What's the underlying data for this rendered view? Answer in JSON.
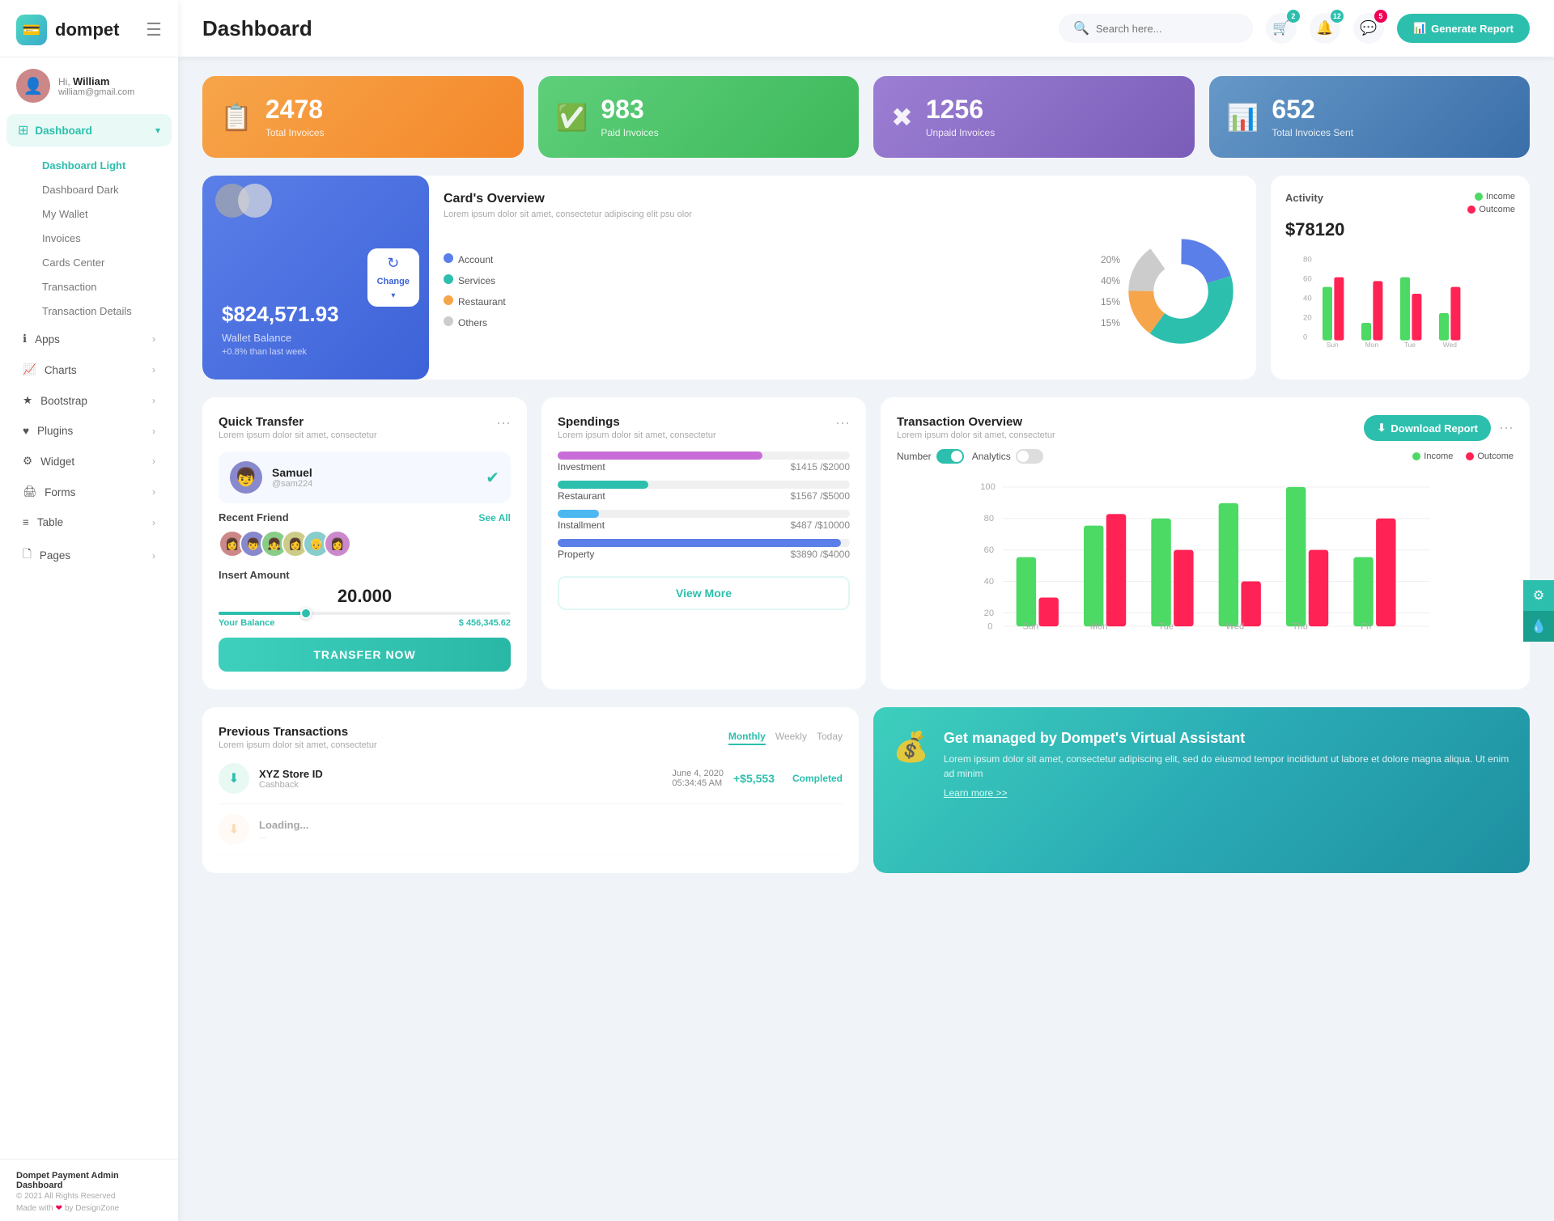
{
  "sidebar": {
    "logo": "dompet",
    "logo_icon": "💳",
    "hamburger": "☰",
    "user": {
      "greeting": "Hi,",
      "name": "William",
      "email": "william@gmail.com",
      "avatar": "👤"
    },
    "nav": [
      {
        "id": "dashboard",
        "label": "Dashboard",
        "icon": "⊞",
        "active": true,
        "arrow": "▾",
        "sub": [
          {
            "label": "Dashboard Light",
            "active": true
          },
          {
            "label": "Dashboard Dark"
          },
          {
            "label": "My Wallet"
          },
          {
            "label": "Invoices"
          },
          {
            "label": "Cards Center"
          },
          {
            "label": "Transaction"
          },
          {
            "label": "Transaction Details"
          }
        ]
      },
      {
        "id": "apps",
        "label": "Apps",
        "icon": "ℹ",
        "arrow": "›"
      },
      {
        "id": "charts",
        "label": "Charts",
        "icon": "📈",
        "arrow": "›"
      },
      {
        "id": "bootstrap",
        "label": "Bootstrap",
        "icon": "★",
        "arrow": "›"
      },
      {
        "id": "plugins",
        "label": "Plugins",
        "icon": "♥",
        "arrow": "›"
      },
      {
        "id": "widget",
        "label": "Widget",
        "icon": "⚙",
        "arrow": "›"
      },
      {
        "id": "forms",
        "label": "Forms",
        "icon": "🖨",
        "arrow": "›"
      },
      {
        "id": "table",
        "label": "Table",
        "icon": "≡",
        "arrow": "›"
      },
      {
        "id": "pages",
        "label": "Pages",
        "icon": "🗋",
        "arrow": "›"
      }
    ],
    "footer": {
      "title": "Dompet Payment Admin Dashboard",
      "copy": "© 2021 All Rights Reserved",
      "made": "Made with ❤ by DesignZone"
    }
  },
  "header": {
    "title": "Dashboard",
    "search_placeholder": "Search here...",
    "search_icon": "🔍",
    "icons": [
      {
        "id": "bell",
        "icon": "🛒",
        "badge": "2",
        "badge_color": "teal"
      },
      {
        "id": "notification",
        "icon": "🔔",
        "badge": "12",
        "badge_color": "teal"
      },
      {
        "id": "messages",
        "icon": "💬",
        "badge": "5",
        "badge_color": "red"
      }
    ],
    "btn_generate": "Generate Report"
  },
  "stats": [
    {
      "label": "Total Invoices",
      "value": "2478",
      "icon": "📋",
      "color": "stat-orange"
    },
    {
      "label": "Paid Invoices",
      "value": "983",
      "icon": "✅",
      "color": "stat-green"
    },
    {
      "label": "Unpaid Invoices",
      "value": "1256",
      "icon": "✖",
      "color": "stat-purple"
    },
    {
      "label": "Total Invoices Sent",
      "value": "652",
      "icon": "📊",
      "color": "stat-blue"
    }
  ],
  "wallet_card": {
    "amount": "$824,571.93",
    "label": "Wallet Balance",
    "change": "+0.8% than last week",
    "refresh_label": "Change"
  },
  "card_overview": {
    "title": "Card's Overview",
    "desc": "Lorem ipsum dolor sit amet, consectetur adipiscing elit psu olor",
    "items": [
      {
        "label": "Account",
        "pct": "20%",
        "color": "#5b7fe8"
      },
      {
        "label": "Services",
        "pct": "40%",
        "color": "#2dbfad"
      },
      {
        "label": "Restaurant",
        "pct": "15%",
        "color": "#f7a54a"
      },
      {
        "label": "Others",
        "pct": "15%",
        "color": "#ccc"
      }
    ]
  },
  "activity": {
    "title": "Activity",
    "amount": "$78120",
    "legend": [
      {
        "label": "Income",
        "color": "#4cd964"
      },
      {
        "label": "Outcome",
        "color": "#f25"
      },
      {
        "label": "Outcome",
        "color": "#f25"
      }
    ],
    "bars": {
      "labels": [
        "Sun",
        "Mon",
        "Tue",
        "Wed"
      ],
      "income": [
        55,
        15,
        65,
        30
      ],
      "outcome": [
        70,
        60,
        45,
        55
      ]
    }
  },
  "quick_transfer": {
    "title": "Quick Transfer",
    "desc": "Lorem ipsum dolor sit amet, consectetur",
    "user": {
      "name": "Samuel",
      "handle": "@sam224",
      "avatar": "👦"
    },
    "recent_label": "Recent Friend",
    "see_all": "See All",
    "avatars": [
      "👩",
      "👦",
      "👧",
      "👩‍🦱",
      "👴",
      "👩‍🦰"
    ],
    "insert_amount_label": "Insert Amount",
    "amount": "20.000",
    "balance_label": "Your Balance",
    "balance_value": "$ 456,345.62",
    "btn_label": "TRANSFER NOW"
  },
  "spendings": {
    "title": "Spendings",
    "desc": "Lorem ipsum dolor sit amet, consectetur",
    "items": [
      {
        "label": "Investment",
        "amount": "$1415",
        "total": "$2000",
        "pct": 70,
        "color": "#c86dd7"
      },
      {
        "label": "Restaurant",
        "amount": "$1567",
        "total": "$5000",
        "pct": 31,
        "color": "#2dbfad"
      },
      {
        "label": "Installment",
        "amount": "$487",
        "total": "$10000",
        "pct": 14,
        "color": "#4db8f0"
      },
      {
        "label": "Property",
        "amount": "$3890",
        "total": "$4000",
        "pct": 97,
        "color": "#5b7fe8"
      }
    ],
    "btn_label": "View More"
  },
  "tx_overview": {
    "title": "Transaction Overview",
    "desc": "Lorem ipsum dolor sit amet, consectetur",
    "btn_download": "Download Report",
    "toggle_number": "Number",
    "toggle_analytics": "Analytics",
    "legend": [
      {
        "label": "Income",
        "color": "#4cd964"
      },
      {
        "label": "Outcome",
        "color": "#f25"
      }
    ],
    "bars": {
      "labels": [
        "Sun",
        "Mon",
        "Tue",
        "Wed",
        "Thu",
        "Fri"
      ],
      "income": [
        45,
        68,
        72,
        85,
        90,
        55
      ],
      "outcome": [
        15,
        78,
        55,
        28,
        48,
        68
      ]
    }
  },
  "prev_transactions": {
    "title": "Previous Transactions",
    "desc": "Lorem ipsum dolor sit amet, consectetur",
    "tabs": [
      "Monthly",
      "Weekly",
      "Today"
    ],
    "active_tab": "Monthly",
    "items": [
      {
        "icon": "⬇",
        "icon_color": "green",
        "name": "XYZ Store ID",
        "sub": "Cashback",
        "date": "June 4, 2020",
        "time": "05:34:45 AM",
        "amount": "+$5,553",
        "status": "Completed"
      }
    ]
  },
  "va": {
    "icon": "💰",
    "title": "Get managed by Dompet's Virtual Assistant",
    "desc": "Lorem ipsum dolor sit amet, consectetur adipiscing elit, sed do eiusmod tempor incididunt ut labore et dolore magna aliqua. Ut enim ad minim",
    "link": "Learn more >>"
  },
  "float_btns": [
    {
      "icon": "⚙",
      "id": "settings"
    },
    {
      "icon": "💧",
      "id": "theme"
    }
  ]
}
